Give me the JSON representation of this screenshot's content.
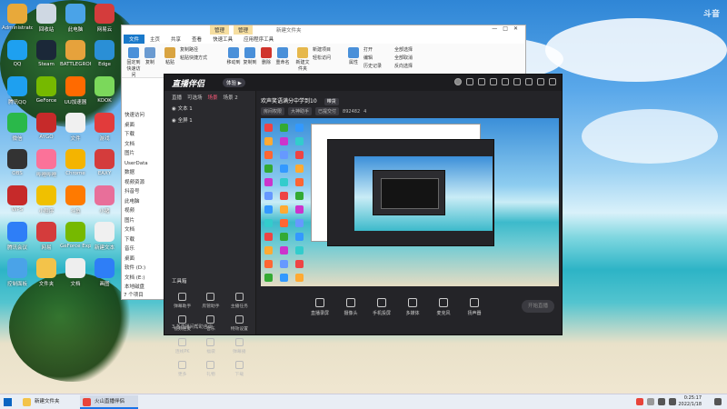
{
  "desktop": {
    "icons": [
      {
        "label": "Administrator",
        "color": "#e8a93a"
      },
      {
        "label": "回收站",
        "color": "#cfd8e3"
      },
      {
        "label": "此电脑",
        "color": "#4aa3e8"
      },
      {
        "label": "网易云",
        "color": "#d43c3c"
      },
      {
        "label": "QQ",
        "color": "#1ea0f0"
      },
      {
        "label": "Steam",
        "color": "#1b2838"
      },
      {
        "label": "BATTLEGROUNDS",
        "color": "#e6a23c"
      },
      {
        "label": "Edge",
        "color": "#2a8fd6"
      },
      {
        "label": "腾讯QQ",
        "color": "#1ea0f0"
      },
      {
        "label": "GeForce",
        "color": "#76b900"
      },
      {
        "label": "UU加速器",
        "color": "#ff6a00"
      },
      {
        "label": "KOOK",
        "color": "#7bd85b"
      },
      {
        "label": "微信",
        "color": "#2ab84a"
      },
      {
        "label": "AYGO",
        "color": "#c62a2a"
      },
      {
        "label": "文件",
        "color": "#f0f0f0"
      },
      {
        "label": "游戏",
        "color": "#e23b3b"
      },
      {
        "label": "OBS",
        "color": "#333333"
      },
      {
        "label": "哔哩哔哩",
        "color": "#fb7299"
      },
      {
        "label": "Chrome",
        "color": "#f4b400"
      },
      {
        "label": "EAXY",
        "color": "#d43c3c"
      },
      {
        "label": "WPS",
        "color": "#c62a2a"
      },
      {
        "label": "小程序",
        "color": "#f0c000"
      },
      {
        "label": "斗鱼",
        "color": "#ff7a00"
      },
      {
        "label": "小猪",
        "color": "#e86f9a"
      },
      {
        "label": "腾讯会议",
        "color": "#2e7ef7"
      },
      {
        "label": "网易",
        "color": "#d43c3c"
      },
      {
        "label": "GeForce Experience",
        "color": "#76b900"
      },
      {
        "label": "新建文本",
        "color": "#f0f0f0"
      },
      {
        "label": "控制面板",
        "color": "#4aa3e8"
      },
      {
        "label": "文件夹",
        "color": "#f3c34a"
      },
      {
        "label": "文档",
        "color": "#eeeeee"
      },
      {
        "label": "画图",
        "color": "#2e7ef7"
      }
    ]
  },
  "explorer": {
    "ribbon_ctx1": "管理",
    "ribbon_ctx2": "管理",
    "title": "新建文件夹",
    "tabs": [
      "文件",
      "主页",
      "共享",
      "查看",
      "快速工具",
      "应用程序工具"
    ],
    "buttons": [
      {
        "label": "固定到快速访问"
      },
      {
        "label": "复制"
      },
      {
        "label": "粘贴"
      },
      {
        "label": "移动到"
      },
      {
        "label": "复制到"
      },
      {
        "label": "删除"
      },
      {
        "label": "重命名"
      },
      {
        "label": "新建文件夹"
      },
      {
        "label": "属性"
      }
    ],
    "small": [
      "复制路径",
      "粘贴快捷方式",
      "新建项目",
      "轻松访问",
      "打开",
      "编辑",
      "历史记录",
      "全部选择",
      "全部取消",
      "反向选择"
    ],
    "tree": [
      "快速访问",
      "桌面",
      "下载",
      "文档",
      "图片",
      "UserData",
      "数据",
      "视频资源",
      "抖音号",
      "此电脑",
      "视频",
      "图片",
      "文档",
      "下载",
      "音乐",
      "桌面",
      "软件 (D:)",
      "文档 (E:)",
      "本地磁盘"
    ],
    "status": "7 个项目"
  },
  "live": {
    "logo": "直播伴侣",
    "version": "体验 ▶",
    "tabs": [
      "直播",
      "可选场",
      "场景",
      "场景 2"
    ],
    "scenes": [
      "文本 1",
      "全屏 1"
    ],
    "room_title": "欢声笑语满分中学到10",
    "room_tag": "带货",
    "info": [
      "房间权限",
      "大神助手",
      "已提交付",
      "892482",
      "4"
    ],
    "tool_title": "工具箱",
    "tools": [
      {
        "label": "弹幕助手"
      },
      {
        "label": "房管助手"
      },
      {
        "label": "主播任务"
      },
      {
        "label": "视频连麦"
      },
      {
        "label": "音乐"
      },
      {
        "label": "特效设置"
      },
      {
        "label": "连线PK"
      },
      {
        "label": "福袋"
      },
      {
        "label": "弹幕播"
      },
      {
        "label": "更多"
      },
      {
        "label": "礼物"
      },
      {
        "label": "下载"
      }
    ],
    "controls": [
      "直播录屏",
      "摄像头",
      "手机投屏",
      "多媒体",
      "麦克风",
      "扬声器"
    ],
    "start": "开始直播",
    "bottom": "3.各直播间帮助咨询"
  },
  "taskbar": {
    "items": [
      {
        "label": "新建文件夹",
        "color": "#f3c34a"
      },
      {
        "label": "火山直播伴侣",
        "color": "#e8443a"
      }
    ],
    "time": "0:25:17",
    "date": "2022/1/18"
  },
  "watermark": "斗音"
}
